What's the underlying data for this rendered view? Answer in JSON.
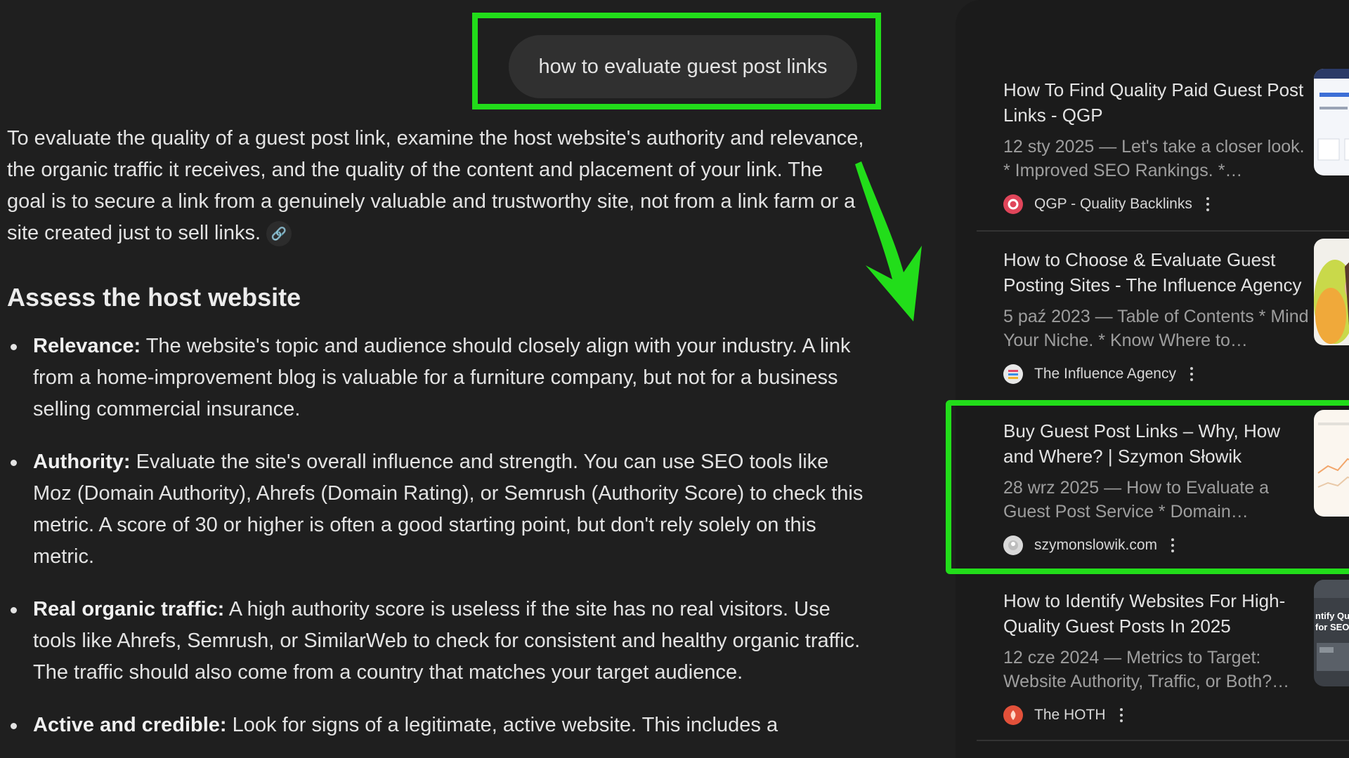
{
  "query": {
    "text": "how to evaluate guest post links"
  },
  "answer": {
    "intro": "To evaluate the quality of a guest post link, examine the host website's authority and relevance, the organic traffic it receives, and the quality of the content and placement of your link. The goal is to secure a link from a genuinely valuable and trustworthy site, not from a link farm or a site created just to sell links.",
    "section_title": "Assess the host website",
    "bullets": [
      {
        "term": "Relevance:",
        "text": " The website's topic and audience should closely align with your industry. A link from a home-improvement blog is valuable for a furniture company, but not for a business selling commercial insurance."
      },
      {
        "term": "Authority:",
        "text": " Evaluate the site's overall influence and strength. You can use SEO tools like Moz (Domain Authority), Ahrefs (Domain Rating), or Semrush (Authority Score) to check this metric. A score of 30 or higher is often a good starting point, but don't rely solely on this metric."
      },
      {
        "term": "Real organic traffic:",
        "text": " A high authority score is useless if the site has no real visitors. Use tools like Ahrefs, Semrush, or SimilarWeb to check for consistent and healthy organic traffic. The traffic should also come from a country that matches your target audience."
      },
      {
        "term": "Active and credible:",
        "text": " Look for signs of a legitimate, active website. This includes a"
      }
    ]
  },
  "sources": [
    {
      "title": "How To Find Quality Paid Guest Post Links - QGP",
      "snippet": "12 sty 2025 — Let's take a closer look. * Improved SEO Rankings. *…",
      "source": "QGP - Quality Backlinks",
      "favicon_color": "#e0455a",
      "thumb_color": "#f4f6fa"
    },
    {
      "title": "How to Choose & Evaluate Guest Posting Sites - The Influence Agency",
      "snippet": "5 paź 2023 — Table of Contents * Mind Your Niche. * Know Where to…",
      "source": "The Influence Agency",
      "favicon_color": "#e8e8e8",
      "thumb_color": "#f2f0ea"
    },
    {
      "title": "Buy Guest Post Links – Why, How and Where? | Szymon Słowik",
      "snippet": "28 wrz 2025 — How to Evaluate a Guest Post Service * Domain…",
      "source": "szymonslowik.com",
      "favicon_color": "#d9d9d9",
      "thumb_color": "#fbf6ef"
    },
    {
      "title": "How to Identify Websites For High-Quality Guest Posts In 2025",
      "snippet": "12 cze 2024 — Metrics to Target: Website Authority, Traffic, or Both?…",
      "source": "The HOTH",
      "favicon_color": "#e2513a",
      "thumb_color": "#3b3f45"
    }
  ],
  "thumb_texts": {
    "hoth": "ntify Quality for SEO"
  },
  "colors": {
    "highlight": "#22dd1a",
    "background": "#1f1f1f",
    "sidebar": "#1b1b1b"
  }
}
